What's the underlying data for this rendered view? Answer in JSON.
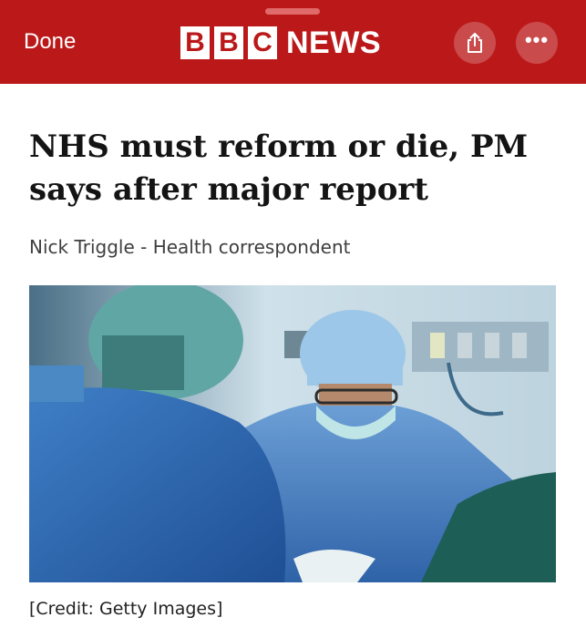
{
  "header": {
    "done_label": "Done",
    "logo_letters": [
      "B",
      "B",
      "C"
    ],
    "logo_word": "NEWS",
    "brand_color": "#bb1919",
    "share_icon": "share-icon",
    "more_icon": "more-icon",
    "more_glyph": "•••"
  },
  "article": {
    "headline": "NHS must reform or die, PM says after major report",
    "byline": "Nick Triggle - Health correspondent",
    "image_credit": "[Credit: Getty Images]"
  }
}
